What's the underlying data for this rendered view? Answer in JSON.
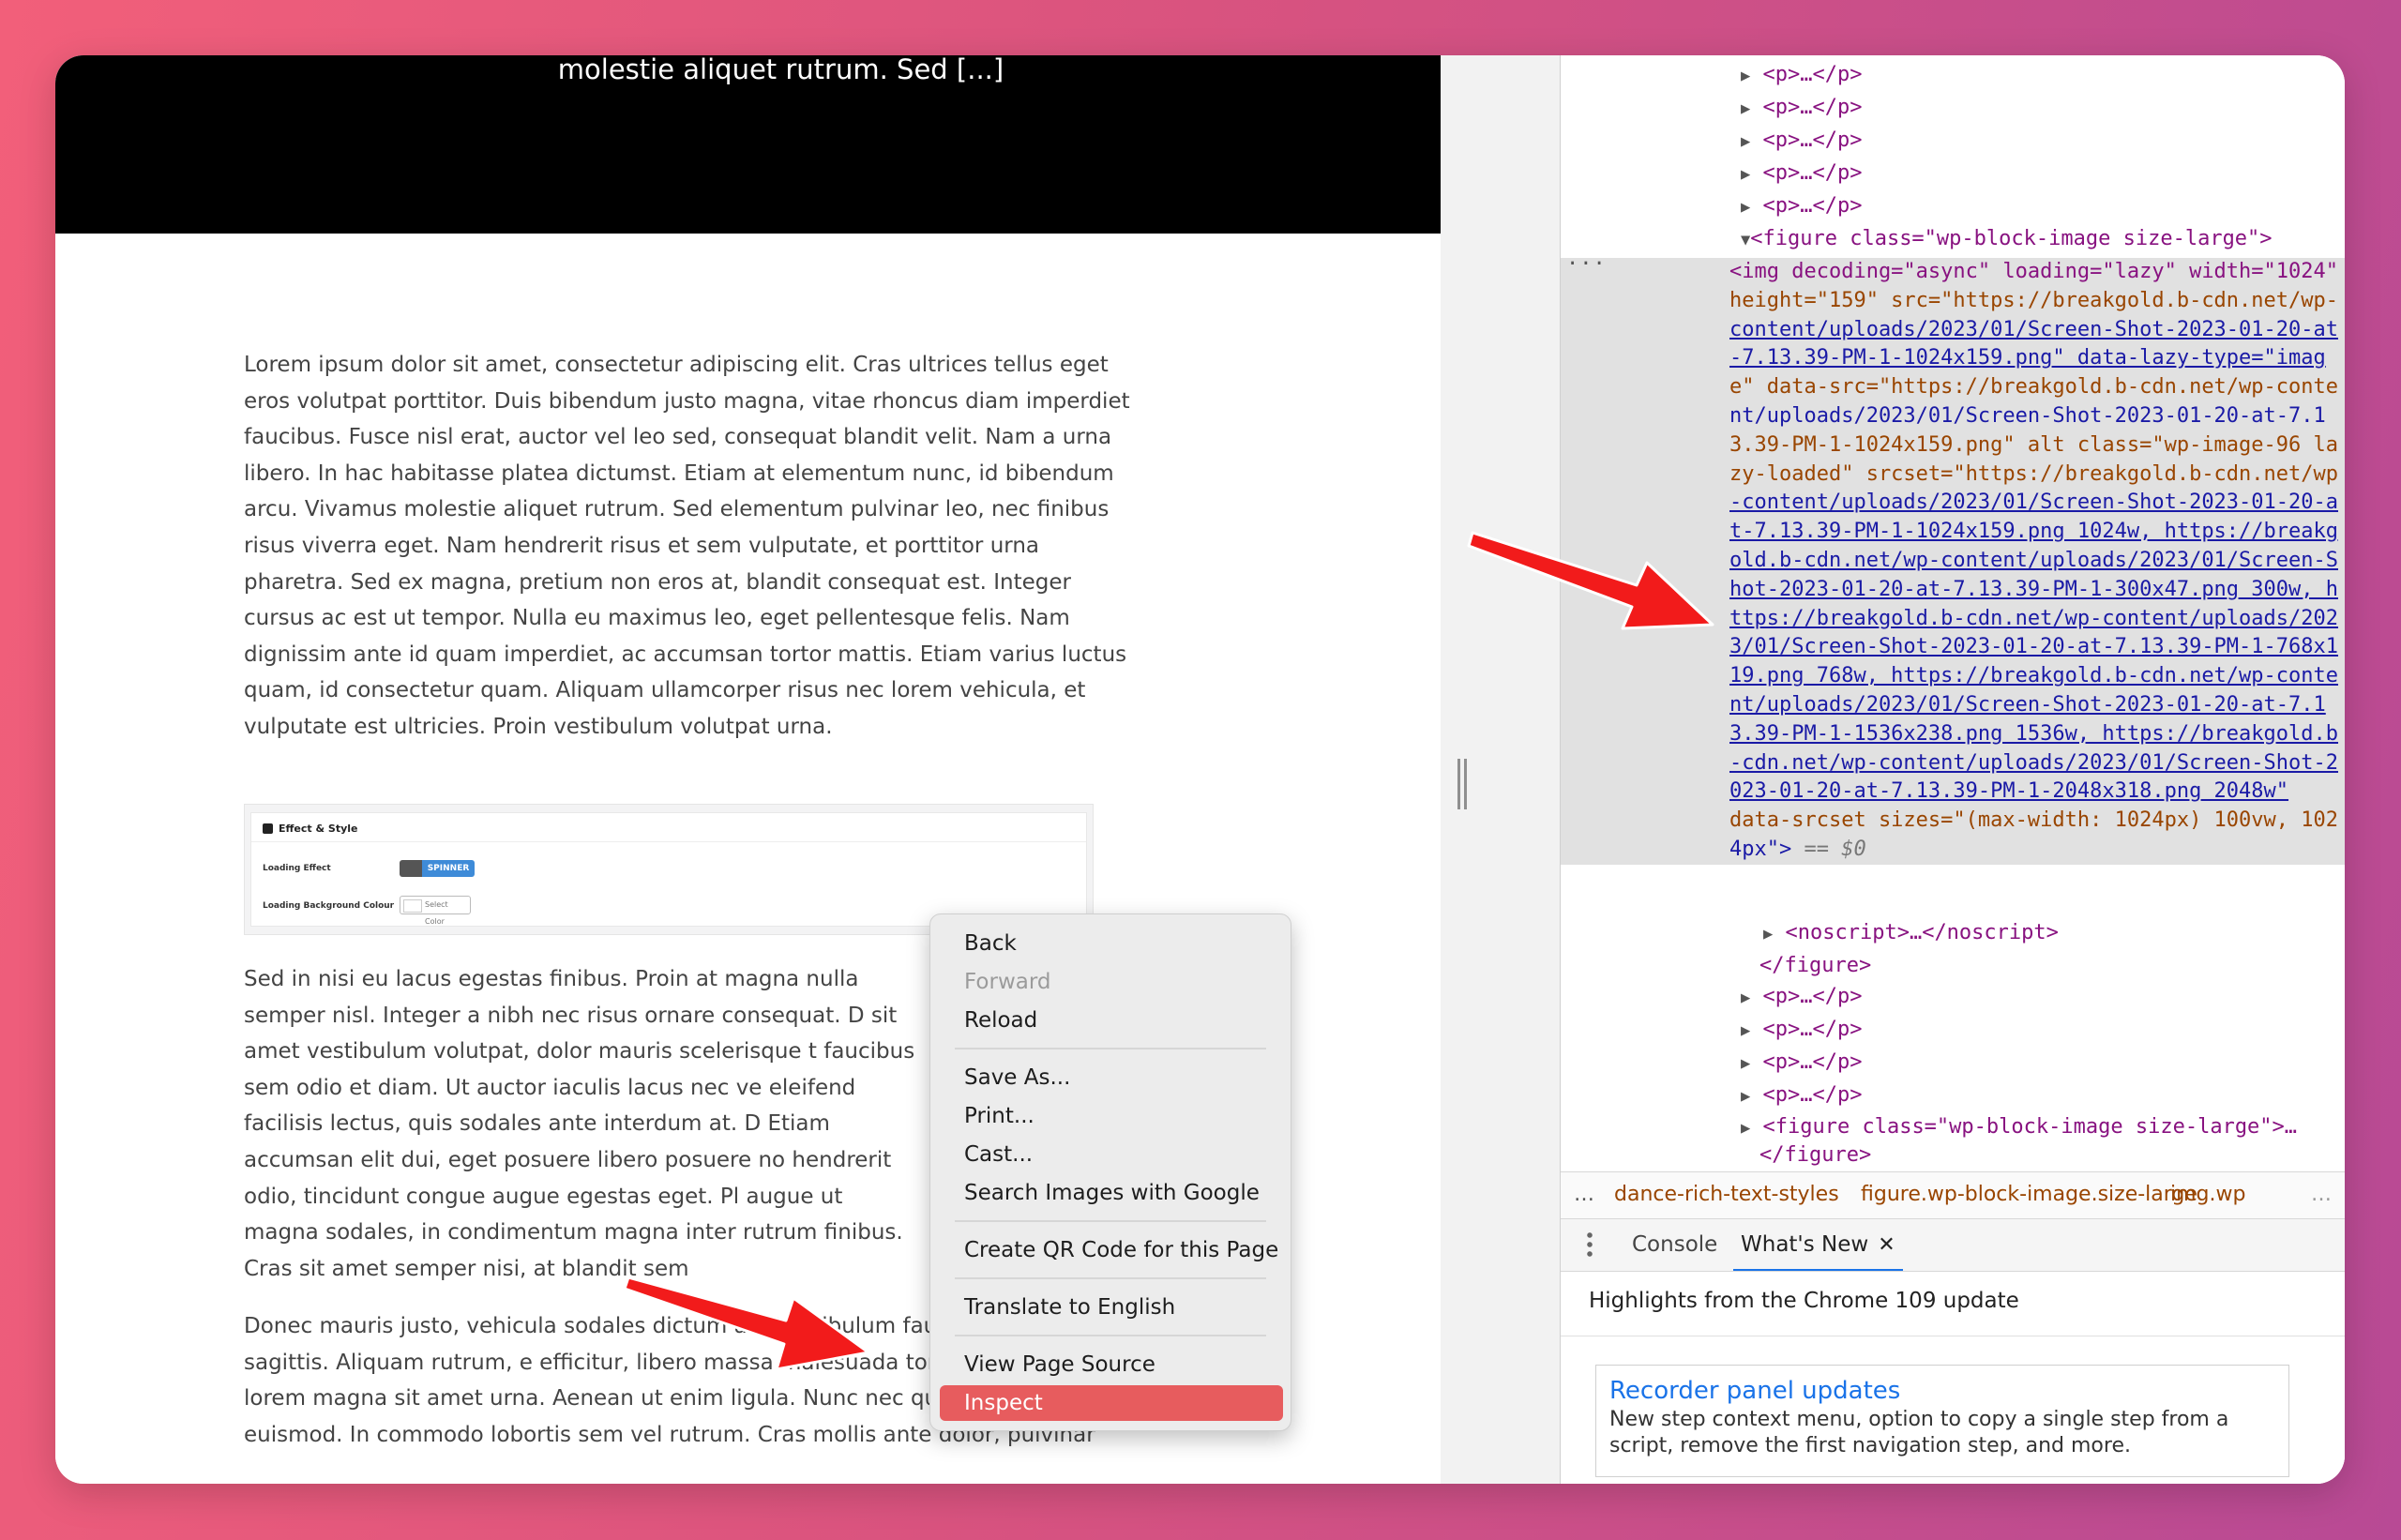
{
  "page": {
    "hero_text": "molestie aliquet rutrum. Sed [...]",
    "paragraph1": "Lorem ipsum dolor sit amet, consectetur adipiscing elit. Cras ultrices tellus eget eros volutpat porttitor. Duis bibendum justo magna, vitae rhoncus diam imperdiet faucibus. Fusce nisl erat, auctor vel leo sed, consequat blandit velit. Nam a urna libero. In hac habitasse platea dictumst. Etiam at elementum nunc, id bibendum arcu. Vivamus molestie aliquet rutrum. Sed elementum pulvinar leo, nec finibus risus viverra eget. Nam hendrerit risus et sem vulputate, et porttitor urna pharetra. Sed ex magna, pretium non eros at, blandit consequat est. Integer cursus ac est ut tempor. Nulla eu maximus leo, eget pellentesque felis. Nam dignissim ante id quam imperdiet, ac accumsan tortor mattis. Etiam varius luctus quam, id consectetur quam. Aliquam ullamcorper risus nec lorem vehicula, et vulputate est ultricies. Proin vestibulum volutpat urna.",
    "paragraph2": "Sed in nisi eu lacus egestas finibus. Proin at magna nulla semper nisl. Integer a nibh nec risus ornare consequat. D sit amet vestibulum volutpat, dolor mauris scelerisque t faucibus sem odio et diam. Ut auctor iaculis lacus nec ve eleifend facilisis lectus, quis sodales ante interdum at. D Etiam accumsan elit dui, eget posuere libero posuere no hendrerit odio, tincidunt congue augue egestas eget. Pl augue ut magna sodales, in condimentum magna inter rutrum finibus. Cras sit amet semper nisi, at blandit sem",
    "paragraph3": "Donec mauris justo, vehicula sodales dictum are Vestibulum faucibus ultricies sagittis. Aliquam rutrum, e efficitur, libero massa malesuada tortor, eu congue lorem magna sit amet urna. Aenean ut enim ligula. Nunc nec quam ac velit auctor euismod. In commodo lobortis sem vel rutrum. Cras mollis ante dolor, pulvinar",
    "settings": {
      "heading": "Effect & Style",
      "loading_effect_label": "Loading Effect",
      "toggle_value": "SPINNER",
      "bg_colour_label": "Loading Background Colour",
      "select_color": "Select Color"
    }
  },
  "context_menu": {
    "back": "Back",
    "forward": "Forward",
    "reload": "Reload",
    "save_as": "Save As...",
    "print": "Print...",
    "cast": "Cast...",
    "search_images": "Search Images with Google",
    "qr_code": "Create QR Code for this Page",
    "translate": "Translate to English",
    "view_source": "View Page Source",
    "inspect": "Inspect"
  },
  "devtools": {
    "p_collapsed": "<p>…</p>",
    "figure_open": "<figure class=\"wp-block-image size-large\">",
    "img_element": {
      "l1": "<img decoding=\"async\" loading=\"lazy\" width=\"1024\"",
      "l2": "height=\"159\" src=\"https://breakgold.b-cdn.net/wp-",
      "l3": "content/uploads/2023/01/Screen-Shot-2023-01-20-at",
      "l4": "-7.13.39-PM-1-1024x159.png\" data-lazy-type=\"imag",
      "l5": "e\" data-src=\"https://breakgold.b-cdn.net/wp-conte",
      "l6": "nt/uploads/2023/01/Screen-Shot-2023-01-20-at-7.1",
      "l7": "3.39-PM-1-1024x159.png\" alt class=\"wp-image-96 la",
      "l8": "zy-loaded\" srcset=\"https://breakgold.b-cdn.net/wp",
      "l9": "-content/uploads/2023/01/Screen-Shot-2023-01-20-a",
      "l10": "t-7.13.39-PM-1-1024x159.png 1024w, https://breakg",
      "l11": "old.b-cdn.net/wp-content/uploads/2023/01/Screen-S",
      "l12": "hot-2023-01-20-at-7.13.39-PM-1-300x47.png 300w, h",
      "l13": "ttps://breakgold.b-cdn.net/wp-content/uploads/202",
      "l14": "3/01/Screen-Shot-2023-01-20-at-7.13.39-PM-1-768x1",
      "l15": "19.png 768w, https://breakgold.b-cdn.net/wp-conte",
      "l16": "nt/uploads/2023/01/Screen-Shot-2023-01-20-at-7.1",
      "l17": "3.39-PM-1-1536x238.png 1536w, https://breakgold.b",
      "l18": "-cdn.net/wp-content/uploads/2023/01/Screen-Shot-2",
      "l19": "023-01-20-at-7.13.39-PM-1-2048x318.png 2048w\"",
      "l20": "data-srcset sizes=\"(max-width: 1024px) 100vw, 102",
      "l21": "4px\">",
      "l21_eq": " == $0"
    },
    "noscript": "<noscript>…</noscript>",
    "figure_close": "</figure>",
    "figure2": "<figure class=\"wp-block-image size-large\">…",
    "breadcrumbs": {
      "dots": "…",
      "item1": "dance-rich-text-styles",
      "item2": "figure.wp-block-image.size-large",
      "item3": "img.wp",
      "end": "…"
    },
    "tabs": {
      "console": "Console",
      "whats_new": "What's New"
    },
    "highlights": "Highlights from the Chrome 109 update",
    "card_title": "Recorder panel updates",
    "card_desc": "New step context menu, option to copy a single step from a script, remove the first navigation step, and more."
  }
}
